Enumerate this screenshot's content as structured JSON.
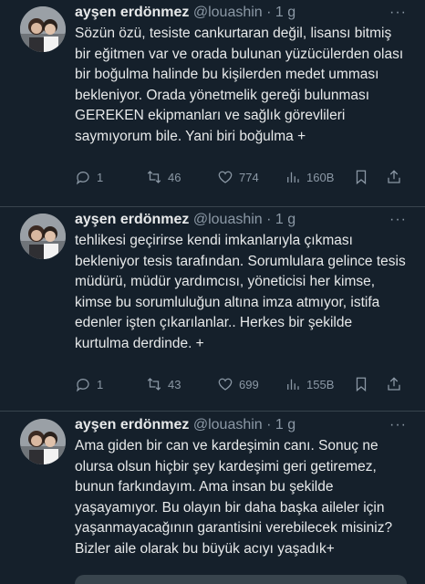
{
  "tweets": [
    {
      "name": "ayşen erdönmez",
      "handle": "@louashin",
      "dot": "·",
      "time": "1 g",
      "more": "···",
      "text": "Sözün özü, tesiste cankurtaran değil, lisansı bitmiş bir eğitmen var ve orada bulunan yüzücülerden olası bir boğulma halinde bu kişilerden medet umması bekleniyor. Orada yönetmelik gereği bulunması GEREKEN ekipmanları ve sağlık görevlileri saymıyorum bile. Yani biri boğulma +",
      "replies": "1",
      "retweets": "46",
      "likes": "774",
      "views": "160B"
    },
    {
      "name": "ayşen erdönmez",
      "handle": "@louashin",
      "dot": "·",
      "time": "1 g",
      "more": "···",
      "text": "tehlikesi geçirirse kendi imkanlarıyla çıkması bekleniyor tesis tarafından. Sorumlulara gelince tesis müdürü, müdür yardımcısı, yöneticisi her kimse, kimse bu sorumluluğun altına imza atmıyor, istifa edenler işten çıkarılanlar.. Herkes bir şekilde kurtulma derdinde. +",
      "replies": "1",
      "retweets": "43",
      "likes": "699",
      "views": "155B"
    },
    {
      "name": "ayşen erdönmez",
      "handle": "@louashin",
      "dot": "·",
      "time": "1 g",
      "more": "···",
      "text": "Ama giden bir can ve kardeşimin canı. Sonuç ne olursa olsun hiçbir şey kardeşimi geri getiremez, bunun farkındayım. Ama insan bu şekilde yaşayamıyor. Bu olayın bir daha başka aileler için yaşanmayacağının garantisini verebilecek misiniz? Bizler aile olarak bu büyük acıyı yaşadık+"
    }
  ],
  "colors": {
    "background": "#15202b",
    "text": "#e7e9ea",
    "secondary": "#8b98a5",
    "divider": "#38444d"
  },
  "icons": [
    "reply-icon",
    "retweet-icon",
    "like-icon",
    "views-icon",
    "bookmark-icon",
    "share-icon",
    "more-icon"
  ]
}
